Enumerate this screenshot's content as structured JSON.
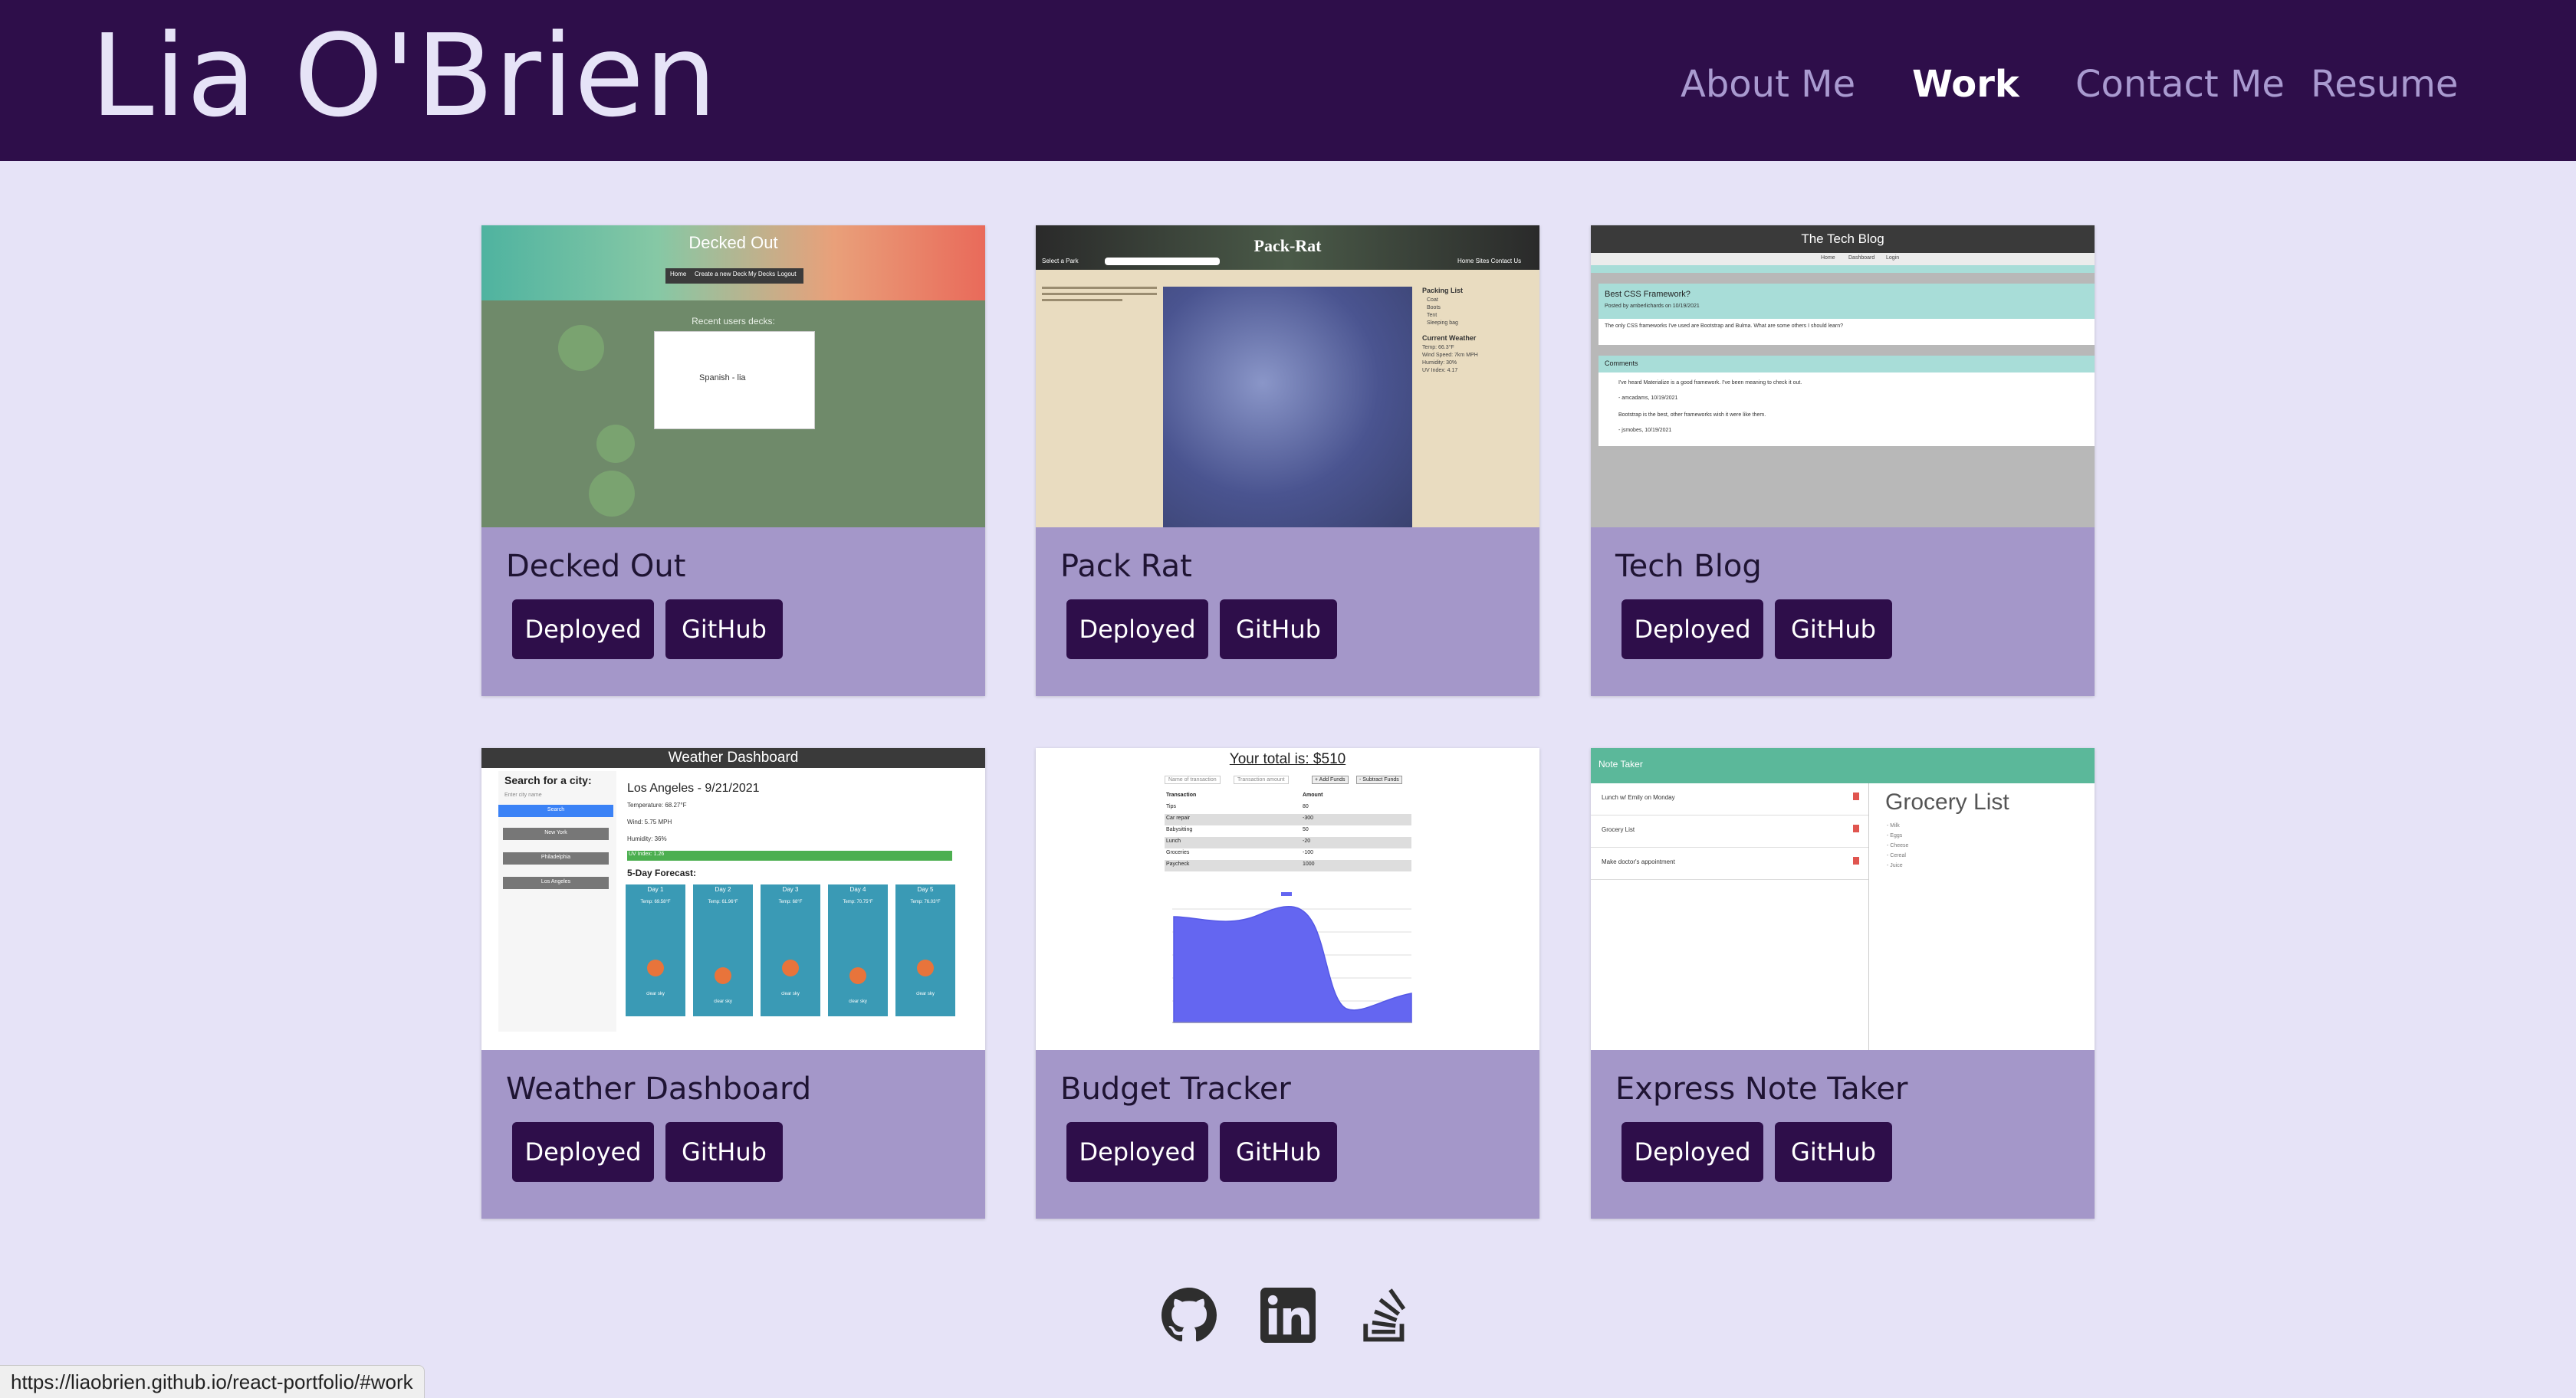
{
  "header": {
    "site_title": "Lia O'Brien",
    "nav": [
      {
        "label": "About Me",
        "active": false
      },
      {
        "label": "Work",
        "active": true
      },
      {
        "label": "Contact Me",
        "active": false
      },
      {
        "label": "Resume",
        "active": false
      }
    ]
  },
  "projects": [
    {
      "title": "Decked Out",
      "deployed_label": "Deployed",
      "github_label": "GitHub",
      "screenshot": {
        "app_title": "Decked Out",
        "nav": [
          "Home",
          "Create a new Deck",
          "My Decks",
          "Logout"
        ],
        "section": "Recent users decks:",
        "deck": "Spanish - lia"
      }
    },
    {
      "title": "Pack Rat",
      "deployed_label": "Deployed",
      "github_label": "GitHub",
      "screenshot": {
        "app_title": "Pack-Rat",
        "select_label": "Select a Park",
        "nav": "Home  Sites  Contact Us",
        "packing_list": "Packing List",
        "packing_items": [
          "Coat",
          "Boots",
          "Tent",
          "Sleeping bag"
        ],
        "weather_title": "Current Weather",
        "weather_lines": [
          "Temp: 66.3°F",
          "Wind Speed: 7km MPH",
          "Humidity: 30%",
          "UV Index: 4.17"
        ]
      }
    },
    {
      "title": "Tech Blog",
      "deployed_label": "Deployed",
      "github_label": "GitHub",
      "screenshot": {
        "app_title": "The Tech Blog",
        "nav": [
          "Home",
          "Dashboard",
          "Login"
        ],
        "post_title": "Best CSS Framework?",
        "post_meta": "Posted by amberlichards on 10/19/2021",
        "post_body": "The only CSS frameworks I've used are Bootstrap and Bulma. What are some others I should learn?",
        "comments_title": "Comments",
        "comments": [
          "I've heard Materialize is a good framework. I've been meaning to check it out.",
          "- amcadams, 10/19/2021",
          "Bootstrap is the best, other frameworks wish it were like them.",
          "- jsmobes, 10/19/2021"
        ]
      }
    },
    {
      "title": "Weather Dashboard",
      "deployed_label": "Deployed",
      "github_label": "GitHub",
      "screenshot": {
        "app_title": "Weather Dashboard",
        "search_title": "Search for a city:",
        "input_placeholder": "Enter city name",
        "search_btn": "Search",
        "cities": [
          "New York",
          "Philadelphia",
          "Los Angeles"
        ],
        "city_heading": "Los Angeles - 9/21/2021",
        "temp": "Temperature: 68.27°F",
        "wind": "Wind: 5.75 MPH",
        "humidity": "Humidity: 36%",
        "uv": "UV Index: 1.26",
        "forecast_title": "5-Day Forecast:",
        "days": [
          "Day 1",
          "Day 2",
          "Day 3",
          "Day 4",
          "Day 5"
        ],
        "day_temps": [
          "Temp: 69.58°F",
          "Temp: 61.96°F",
          "Temp: 68°F",
          "Temp: 70.75°F",
          "Temp: 76.03°F"
        ],
        "day_sky": "clear sky"
      }
    },
    {
      "title": "Budget Tracker",
      "deployed_label": "Deployed",
      "github_label": "GitHub",
      "screenshot": {
        "total": "Your total is: $510",
        "name_placeholder": "Name of transaction",
        "amount_placeholder": "Transaction amount",
        "add_btn": "+ Add Funds",
        "sub_btn": "- Subtract Funds",
        "col_transaction": "Transaction",
        "col_amount": "Amount",
        "rows": [
          [
            "Tips",
            "80"
          ],
          [
            "Car repair",
            "-300"
          ],
          [
            "Babysitting",
            "50"
          ],
          [
            "Lunch",
            "-20"
          ],
          [
            "Groceries",
            "-100"
          ],
          [
            "Paycheck",
            "1000"
          ]
        ]
      }
    },
    {
      "title": "Express Note Taker",
      "deployed_label": "Deployed",
      "github_label": "GitHub",
      "screenshot": {
        "app_title": "Note Taker",
        "notes": [
          "Lunch w/ Emily on Monday",
          "Grocery List",
          "Make doctor's appointment"
        ],
        "note_heading": "Grocery List",
        "note_items": [
          "- Milk",
          "- Eggs",
          "- Cheese",
          "- Cereal",
          "- Juice"
        ]
      }
    }
  ],
  "footer": {
    "icons": [
      "github-icon",
      "linkedin-icon",
      "stackoverflow-icon"
    ]
  },
  "status_bar": {
    "url": "https://liaobrien.github.io/react-portfolio/#work"
  },
  "colors": {
    "header_bg": "#2e0e4a",
    "page_bg": "#e6e3f7",
    "card_bg": "#a497c9",
    "button_bg": "#2e0e4a",
    "nav_inactive": "#a99ad0",
    "nav_active": "#ffffff"
  }
}
